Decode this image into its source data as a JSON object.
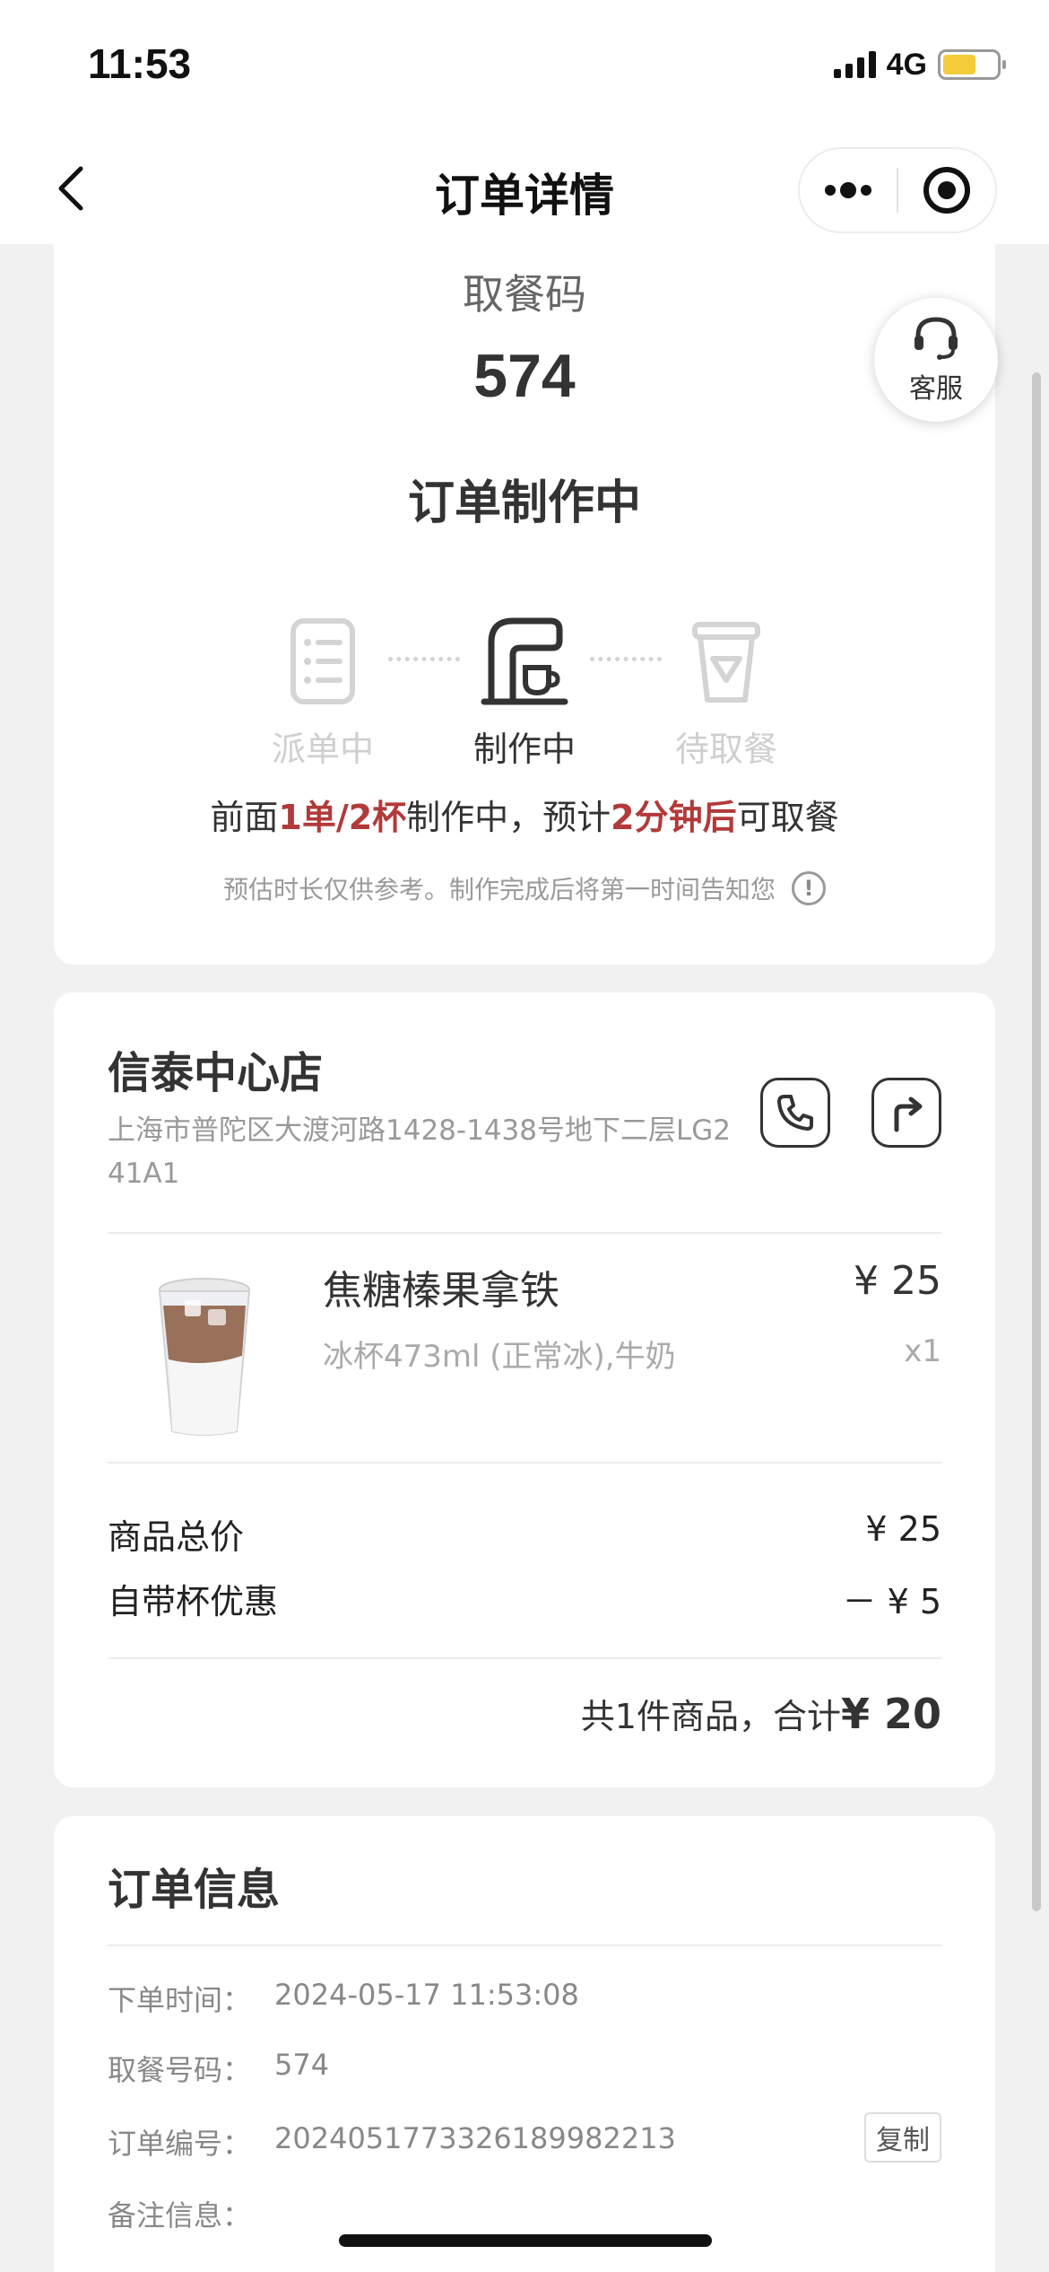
{
  "status_bar": {
    "time": "11:53",
    "network": "4G",
    "battery_color": "#f2cc3a"
  },
  "nav": {
    "title": "订单详情",
    "back_icon": "chevron-left-icon",
    "more_icon": "more-dots-icon",
    "close_icon": "target-circle-icon"
  },
  "pickup": {
    "label": "取餐码",
    "code": "574",
    "status": "订单制作中",
    "steps": [
      {
        "label": "派单中",
        "icon": "order-list-icon",
        "state": "done"
      },
      {
        "label": "制作中",
        "icon": "coffee-machine-icon",
        "state": "active"
      },
      {
        "label": "待取餐",
        "icon": "pickup-cup-icon",
        "state": "pending"
      }
    ],
    "queue": {
      "prefix": "前面",
      "orders": "1单/2杯",
      "middle": "制作中，预计",
      "eta": "2分钟后",
      "suffix": "可取餐"
    },
    "note": "预估时长仅供参考。制作完成后将第一时间告知您",
    "highlight_color": "#b23a3a"
  },
  "customer_service": {
    "label": "客服",
    "icon": "headset-icon"
  },
  "store": {
    "name": "信泰中心店",
    "address": "上海市普陀区大渡河路1428-1438号地下二层LG241A1",
    "phone_icon": "phone-icon",
    "navigate_icon": "navigation-arrow-icon"
  },
  "product": {
    "name": "焦糖榛果拿铁",
    "spec": "冰杯473ml (正常冰),牛奶",
    "price": "¥ 25",
    "qty": "x1",
    "image_icon": "iced-latte-cup"
  },
  "pricing": {
    "subtotal_label": "商品总价",
    "subtotal_value": "¥ 25",
    "discount_label": "自带杯优惠",
    "discount_value": "－ ¥ 5",
    "total_prefix": "共1件商品，合计",
    "total_value": "¥ 20"
  },
  "order_info": {
    "title": "订单信息",
    "order_time_label": "下单时间：",
    "order_time": "2024-05-17 11:53:08",
    "pickup_no_label": "取餐号码：",
    "pickup_no": "574",
    "order_no_label": "订单编号：",
    "order_no": "20240517733261899822​13",
    "copy_label": "复制",
    "remark_label": "备注信息："
  }
}
